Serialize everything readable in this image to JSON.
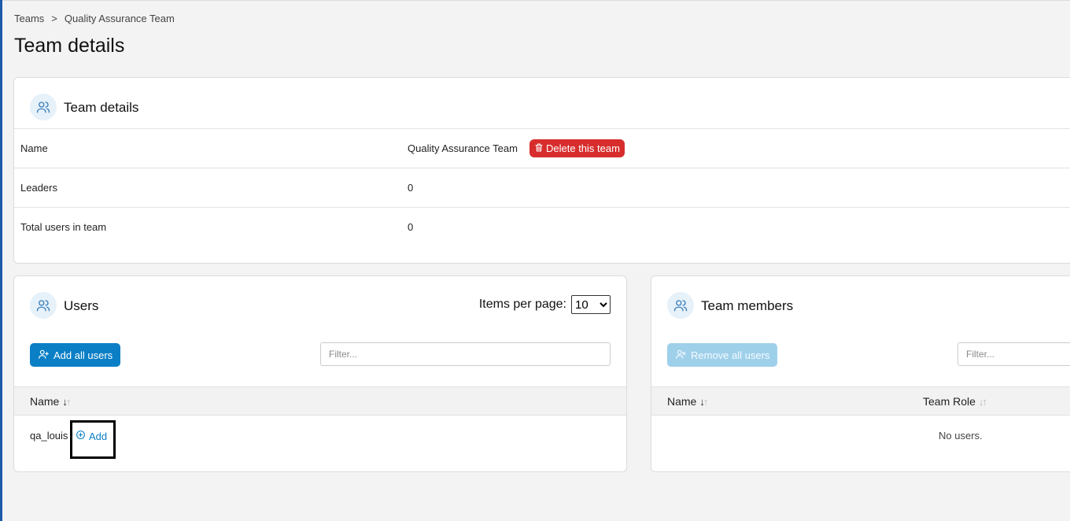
{
  "breadcrumb": {
    "root": "Teams",
    "separator": ">",
    "current": "Quality Assurance Team"
  },
  "page_title": "Team details",
  "details_card": {
    "title": "Team details",
    "icon": "users-icon",
    "rows": [
      {
        "label": "Name",
        "value": "Quality Assurance Team"
      },
      {
        "label": "Leaders",
        "value": "0"
      },
      {
        "label": "Total users in team",
        "value": "0"
      }
    ],
    "delete_button": "Delete this team"
  },
  "users_card": {
    "title": "Users",
    "icon": "users-icon",
    "items_per_page_label": "Items per page:",
    "items_per_page_value": "10",
    "add_all_button": "Add all users",
    "filter_placeholder": "Filter...",
    "column_name": "Name",
    "rows": [
      {
        "name": "qa_louis",
        "action": "Add"
      }
    ]
  },
  "members_card": {
    "title": "Team members",
    "icon": "users-icon",
    "remove_all_button": "Remove all users",
    "filter_placeholder": "Filter...",
    "column_name": "Name",
    "column_role": "Team Role",
    "empty_text": "No users."
  },
  "colors": {
    "primary": "#0a7fc6",
    "danger": "#d82d2d",
    "disabled": "#9fd0ea"
  }
}
